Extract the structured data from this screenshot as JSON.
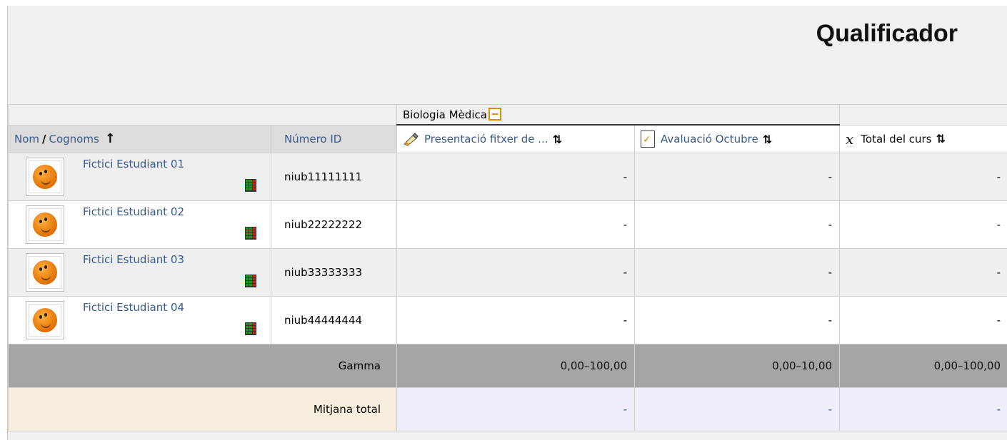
{
  "page": {
    "title": "Qualificador"
  },
  "category": {
    "label": "Biologia Mèdica"
  },
  "headers": {
    "name": {
      "nom": "Nom",
      "sep": "/",
      "cognoms": "Cognoms",
      "sort": "↑"
    },
    "id_label": "Número ID",
    "items": [
      {
        "label": "Presentació fitxer de ...",
        "icon": "assignment-upload-icon",
        "sort": "⇅"
      },
      {
        "label": "Avaluació Octubre",
        "icon": "assignment-doc-icon",
        "sort": "⇅"
      }
    ],
    "total": {
      "label": "Total del curs",
      "icon": "mean-x-bar-icon",
      "sort": "⇅"
    }
  },
  "students": [
    {
      "name": "Fictici Estudiant 01",
      "id": "niub11111111",
      "grades": [
        "-",
        "-",
        "-"
      ]
    },
    {
      "name": "Fictici Estudiant 02",
      "id": "niub22222222",
      "grades": [
        "-",
        "-",
        "-"
      ]
    },
    {
      "name": "Fictici Estudiant 03",
      "id": "niub33333333",
      "grades": [
        "-",
        "-",
        "-"
      ]
    },
    {
      "name": "Fictici Estudiant 04",
      "id": "niub44444444",
      "grades": [
        "-",
        "-",
        "-"
      ]
    }
  ],
  "range": {
    "label": "Gamma",
    "values": [
      "0,00–100,00",
      "0,00–10,00",
      "0,00–100,00"
    ]
  },
  "average": {
    "label": "Mitjana total",
    "values": [
      "-",
      "-",
      "-"
    ]
  },
  "colors": {
    "link": "#3a5a8a",
    "range_bg": "#a5a5a5",
    "avg_label_bg": "#f5eedc",
    "avg_val_bg": "#eeeefb",
    "collapse_box": "#e08a00"
  }
}
